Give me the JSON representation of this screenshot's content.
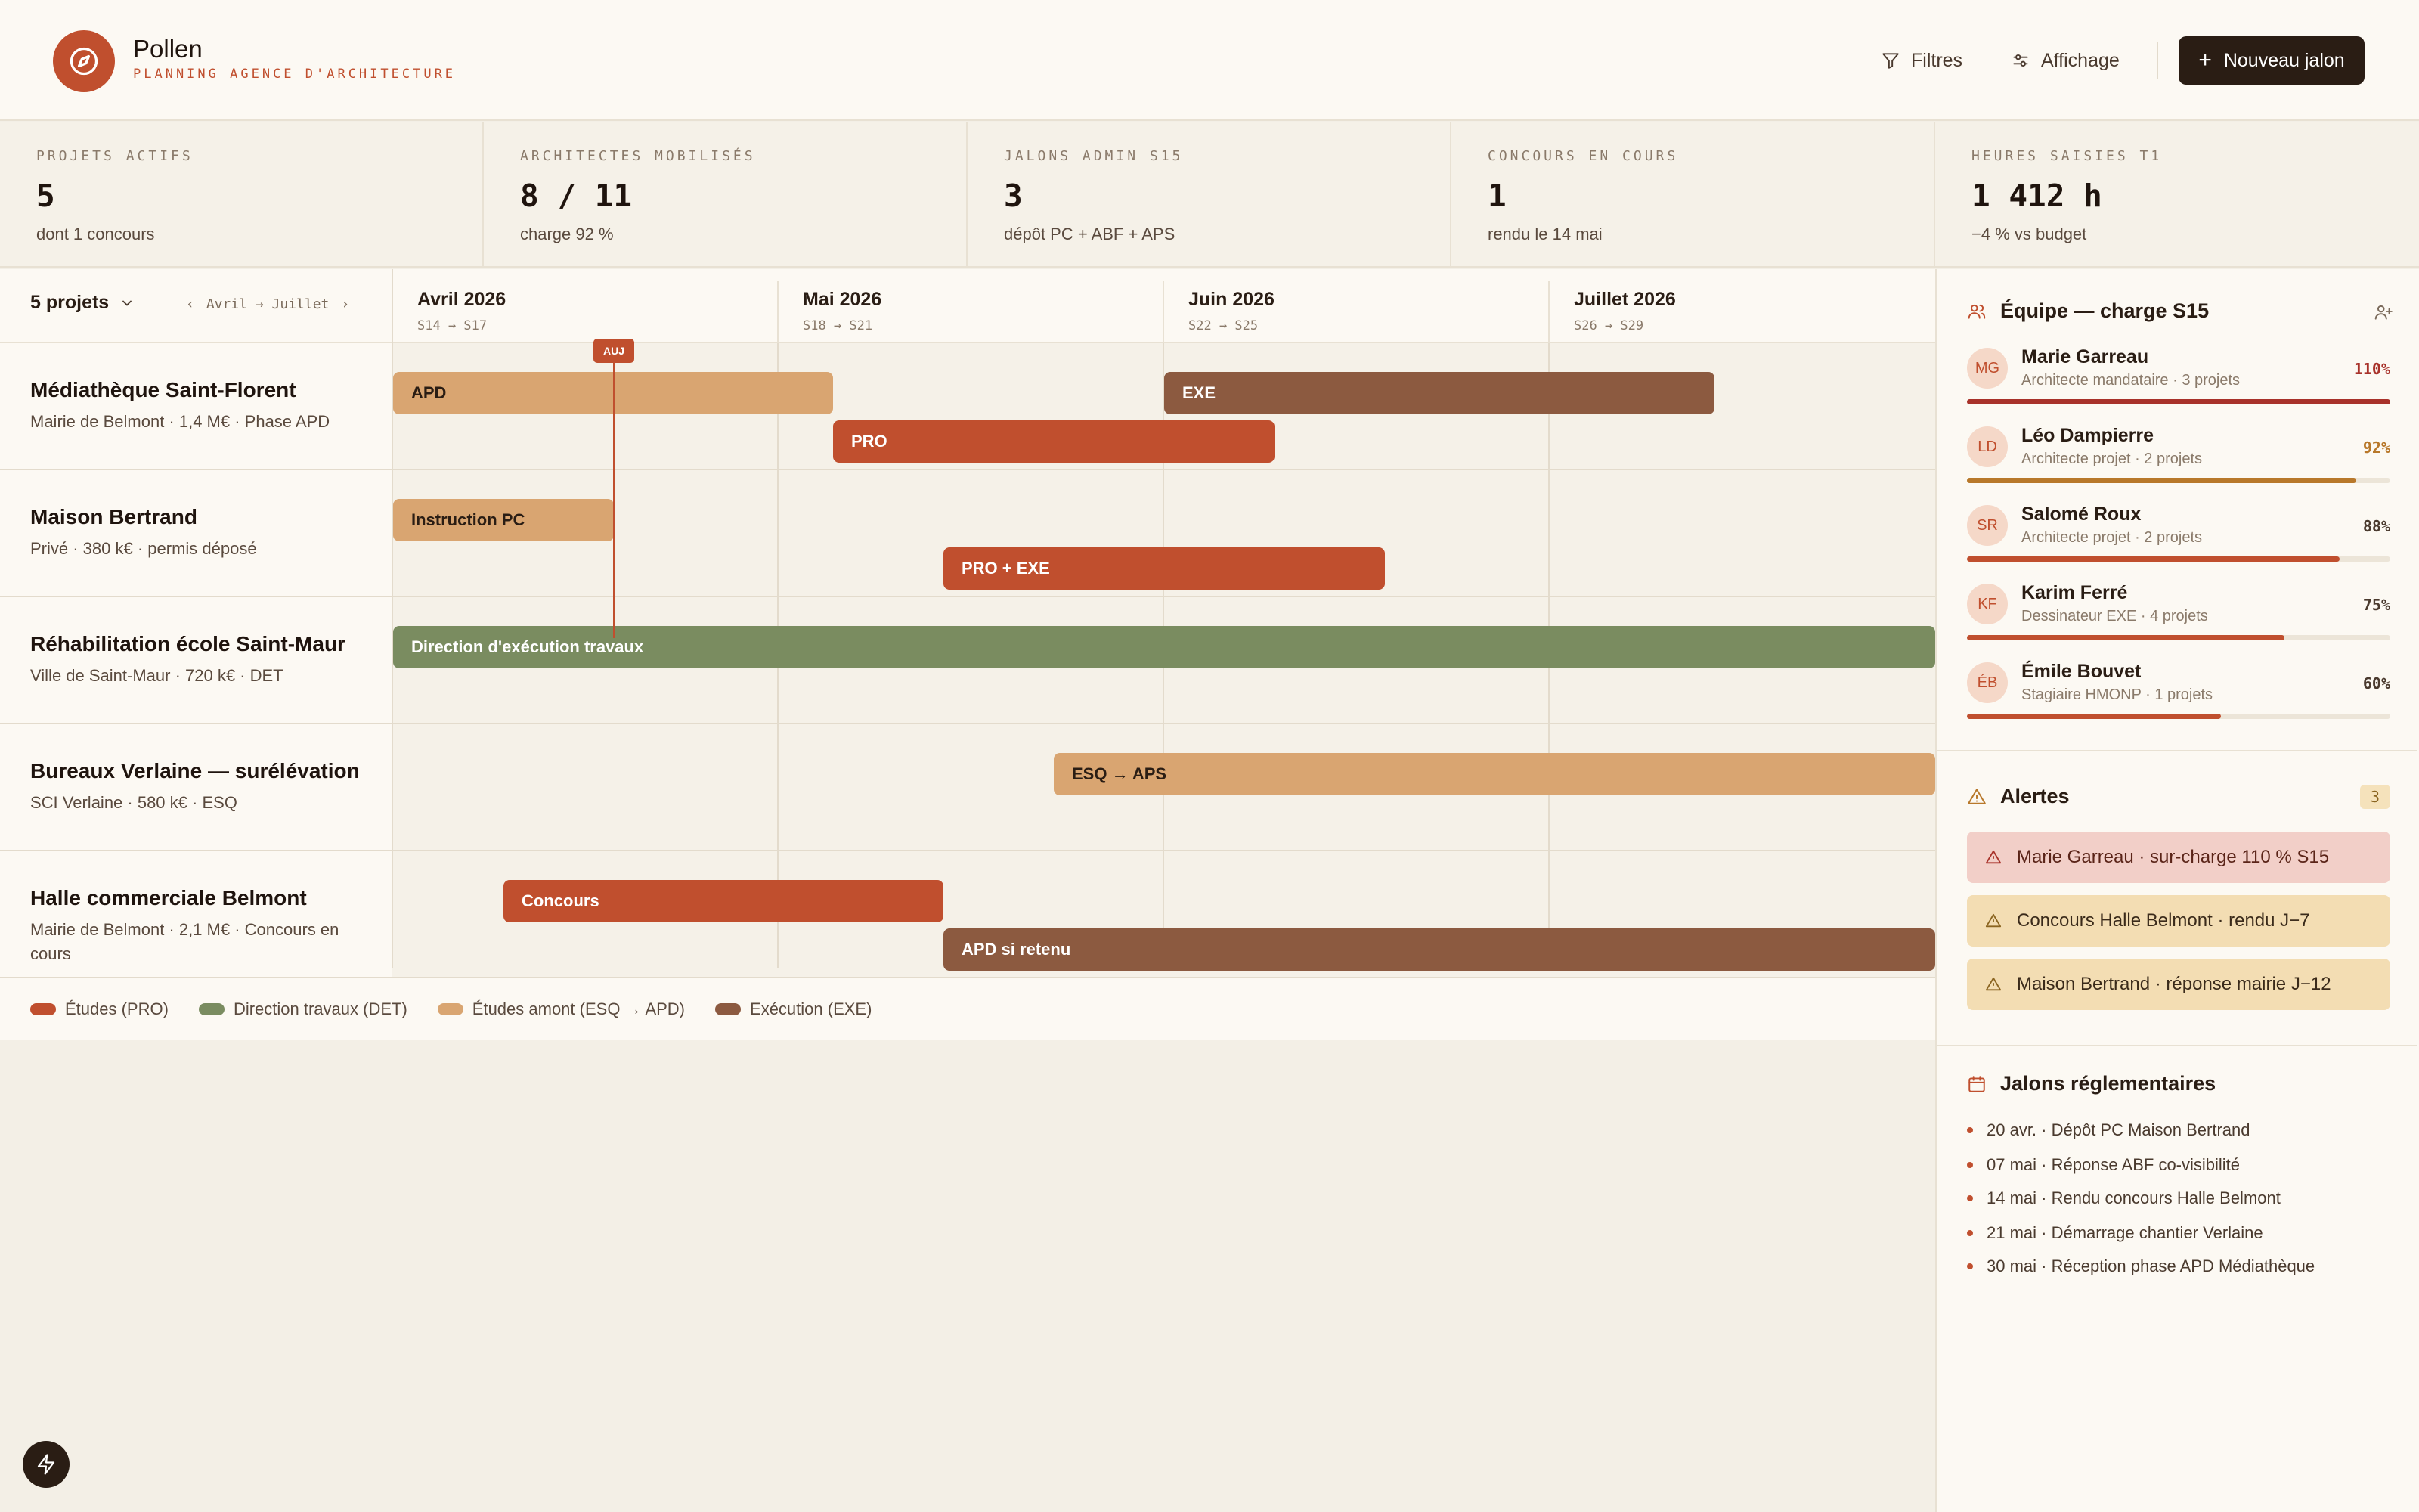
{
  "app": {
    "name": "Pollen",
    "subtitle": "PLANNING AGENCE D'ARCHITECTURE"
  },
  "header": {
    "filters_label": "Filtres",
    "display_label": "Affichage",
    "new_label": "Nouveau jalon"
  },
  "stats": [
    {
      "label": "PROJETS ACTIFS",
      "value": "5",
      "sub": "dont 1 concours"
    },
    {
      "label": "ARCHITECTES MOBILISÉS",
      "value": "8 / 11",
      "sub": "charge 92 %"
    },
    {
      "label": "JALONS ADMIN S15",
      "value": "3",
      "sub": "dépôt PC + ABF + APS"
    },
    {
      "label": "CONCOURS EN COURS",
      "value": "1",
      "sub": "rendu le 14 mai"
    },
    {
      "label": "HEURES SAISIES T1",
      "value": "1 412 h",
      "sub": "−4 % vs budget"
    }
  ],
  "gantt": {
    "project_count": "5 projets",
    "range": "Avril → Juillet",
    "today": "AUJ",
    "months": [
      {
        "name": "Avril 2026",
        "weeks": "S14 → S17"
      },
      {
        "name": "Mai 2026",
        "weeks": "S18 → S21"
      },
      {
        "name": "Juin 2026",
        "weeks": "S22 → S25"
      },
      {
        "name": "Juillet 2026",
        "weeks": "S26 → S29"
      }
    ],
    "projects": [
      {
        "name": "Médiathèque Saint-Florent",
        "meta": "Mairie de Belmont · 1,4 M€ · Phase APD",
        "bars": [
          {
            "label": "APD",
            "type": "esq"
          },
          {
            "label": "EXE",
            "type": "exe"
          },
          {
            "label": "PRO",
            "type": "pro"
          }
        ]
      },
      {
        "name": "Maison Bertrand",
        "meta": "Privé · 380 k€ · permis déposé",
        "bars": [
          {
            "label": "Instruction PC",
            "type": "esq"
          },
          {
            "label": "PRO + EXE",
            "type": "pro"
          }
        ]
      },
      {
        "name": "Réhabilitation école Saint-Maur",
        "meta": "Ville de Saint-Maur · 720 k€ · DET",
        "bars": [
          {
            "label": "Direction d'exécution travaux",
            "type": "det"
          }
        ]
      },
      {
        "name": "Bureaux Verlaine — surélévation",
        "meta": "SCI Verlaine · 580 k€ · ESQ",
        "bars": [
          {
            "label": "ESQ → APS",
            "type": "esq"
          }
        ]
      },
      {
        "name": "Halle commerciale Belmont",
        "meta": "Mairie de Belmont · 2,1 M€ · Concours en cours",
        "bars": [
          {
            "label": "Concours",
            "type": "pro"
          },
          {
            "label": "APD si retenu",
            "type": "exe"
          }
        ]
      }
    ],
    "legend": [
      {
        "label": "Études (PRO)",
        "color": "#c04f2e"
      },
      {
        "label": "Direction travaux (DET)",
        "color": "#7a8c60"
      },
      {
        "label": "Études amont (ESQ → APD)",
        "color": "#d9a571"
      },
      {
        "label": "Exécution (EXE)",
        "color": "#8c5a40"
      }
    ]
  },
  "team": {
    "title": "Équipe — charge S15",
    "members": [
      {
        "initials": "MG",
        "name": "Marie Garreau",
        "role": "Architecte mandataire · 3 projets",
        "pct": "110%",
        "load": 1.0,
        "color": "#a8322a"
      },
      {
        "initials": "LD",
        "name": "Léo Dampierre",
        "role": "Architecte projet · 2 projets",
        "pct": "92%",
        "load": 0.92,
        "color": "#b8782a"
      },
      {
        "initials": "SR",
        "name": "Salomé Roux",
        "role": "Architecte projet · 2 projets",
        "pct": "88%",
        "load": 0.88,
        "color": "#c04f2e"
      },
      {
        "initials": "KF",
        "name": "Karim Ferré",
        "role": "Dessinateur EXE · 4 projets",
        "pct": "75%",
        "load": 0.75,
        "color": "#c04f2e"
      },
      {
        "initials": "ÉB",
        "name": "Émile Bouvet",
        "role": "Stagiaire HMONP · 1 projets",
        "pct": "60%",
        "load": 0.6,
        "color": "#c04f2e"
      }
    ]
  },
  "alerts": {
    "title": "Alertes",
    "count": "3",
    "items": [
      {
        "text": "Marie Garreau · sur-charge 110 % S15",
        "level": "danger"
      },
      {
        "text": "Concours Halle Belmont · rendu J−7",
        "level": "warn"
      },
      {
        "text": "Maison Bertrand · réponse mairie J−12",
        "level": "warn"
      }
    ]
  },
  "jalons": {
    "title": "Jalons réglementaires",
    "items": [
      "20 avr. · Dépôt PC Maison Bertrand",
      "07 mai · Réponse ABF co-visibilité",
      "14 mai · Rendu concours Halle Belmont",
      "21 mai · Démarrage chantier Verlaine",
      "30 mai · Réception phase APD Médiathèque"
    ]
  }
}
